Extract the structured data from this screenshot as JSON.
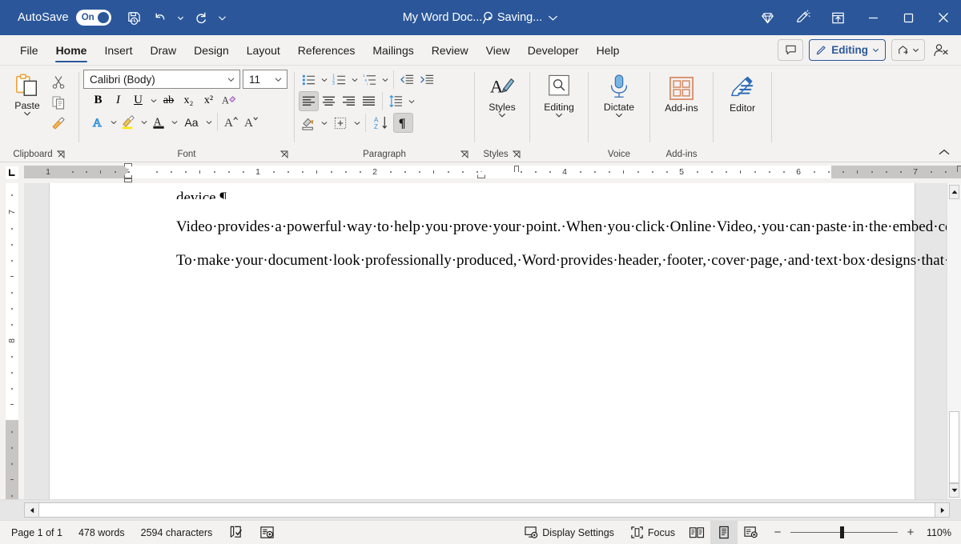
{
  "titlebar": {
    "autosave_label": "AutoSave",
    "autosave_state": "On",
    "doc_title": "My Word Doc...",
    "separator": "•",
    "save_status": "Saving...",
    "bg_color": "#2b579a",
    "qat": [
      {
        "name": "save-icon",
        "tooltip": "Save"
      },
      {
        "name": "undo-icon",
        "tooltip": "Undo"
      },
      {
        "name": "undo-dropdown-icon",
        "tooltip": "Undo options"
      },
      {
        "name": "redo-icon",
        "tooltip": "Redo"
      },
      {
        "name": "customize-quick-access-toolbar-icon",
        "tooltip": "Customize Quick Access Toolbar"
      }
    ],
    "search": {
      "name": "search-icon",
      "tooltip": "Search"
    },
    "right_buttons": [
      {
        "name": "diamond-icon",
        "tooltip": "Microsoft 365"
      },
      {
        "name": "copilot-icon",
        "tooltip": "Copilot"
      },
      {
        "name": "ribbon-display-options-icon",
        "tooltip": "Ribbon Display Options"
      },
      {
        "name": "minimize-icon",
        "tooltip": "Minimize"
      },
      {
        "name": "maximize-icon",
        "tooltip": "Restore Down"
      },
      {
        "name": "close-icon",
        "tooltip": "Close"
      }
    ]
  },
  "tabs": [
    {
      "label": "File",
      "active": false
    },
    {
      "label": "Home",
      "active": true
    },
    {
      "label": "Insert",
      "active": false
    },
    {
      "label": "Draw",
      "active": false
    },
    {
      "label": "Design",
      "active": false
    },
    {
      "label": "Layout",
      "active": false
    },
    {
      "label": "References",
      "active": false
    },
    {
      "label": "Mailings",
      "active": false
    },
    {
      "label": "Review",
      "active": false
    },
    {
      "label": "View",
      "active": false
    },
    {
      "label": "Developer",
      "active": false
    },
    {
      "label": "Help",
      "active": false
    }
  ],
  "tabbar_right": {
    "comments_label": "",
    "editing_label": "Editing",
    "share_label": "",
    "accent_color": "#2b579a"
  },
  "ribbon": {
    "groups": [
      {
        "label": "Clipboard",
        "has_launcher": true
      },
      {
        "label": "Font",
        "has_launcher": true
      },
      {
        "label": "Paragraph",
        "has_launcher": true
      },
      {
        "label": "Styles",
        "has_launcher": true
      },
      {
        "label": "",
        "has_launcher": false
      },
      {
        "label": "Voice",
        "has_launcher": false
      },
      {
        "label": "Add-ins",
        "has_launcher": false
      },
      {
        "label": "",
        "has_launcher": false
      }
    ],
    "clipboard": {
      "paste_label": "Paste",
      "cut_name": "cut-icon",
      "copy_name": "copy-icon",
      "format_painter_name": "format-painter-icon"
    },
    "font": {
      "font_name": "Calibri (Body)",
      "font_size": "11",
      "bold": "B",
      "italic": "I",
      "underline": "U",
      "strikethrough": "ab",
      "subscript": "x₂",
      "superscript": "x²",
      "clear_formatting_name": "clear-formatting-icon",
      "text_effects_name": "text-effects-icon",
      "highlight_name": "text-highlight-color-icon",
      "font_color_name": "font-color-icon",
      "change_case_label": "Aa",
      "grow_font_label": "A",
      "shrink_font_label": "A"
    },
    "paragraph": {
      "bullets_name": "bullets-icon",
      "numbering_name": "numbering-icon",
      "multilevel_name": "multilevel-list-icon",
      "decrease_indent_name": "decrease-indent-icon",
      "increase_indent_name": "increase-indent-icon",
      "align_left_name": "align-left-icon",
      "align_center_name": "align-center-icon",
      "align_right_name": "align-right-icon",
      "justify_name": "justify-icon",
      "line_spacing_name": "line-spacing-icon",
      "shading_name": "shading-icon",
      "borders_name": "borders-icon",
      "sort_name": "sort-icon",
      "show_marks_name": "show-formatting-marks-icon",
      "align_left_selected": true,
      "show_marks_selected": true
    },
    "buttons": [
      {
        "label": "Styles",
        "icon": "styles-icon",
        "has_chevron": true
      },
      {
        "label": "Editing",
        "icon": "editing-search-icon",
        "has_chevron": true
      },
      {
        "label": "Dictate",
        "icon": "dictate-microphone-icon",
        "has_chevron": true
      },
      {
        "label": "Add-ins",
        "icon": "add-ins-icon",
        "has_chevron": false
      },
      {
        "label": "Editor",
        "icon": "editor-pen-icon",
        "has_chevron": false
      }
    ],
    "collapse_name": "collapse-ribbon-icon"
  },
  "ruler": {
    "tab_selector_name": "tab-stop-selector",
    "h_numbers": [
      "1",
      "1",
      "2",
      "4",
      "5",
      "6",
      "7"
    ],
    "v_numbers": [
      "7",
      "8"
    ],
    "left_indent_in": 0.0,
    "right_indent_in": 6.5
  },
  "document": {
    "paragraphs": [
      "device.¶",
      "Video·provides·a·powerful·way·to·help·you·prove·your·point.·When·you·click·Online·Video,·you·can·paste·in·the·embed·code·for·the·video·you·want·to·add.·You·can·also·type·a·keyword·to·search·online·for·the·video·that·best·fits·your·document.¶",
      "To·make·your·document·look·professionally·produced,·Word·provides·header,·footer,·cover·page,·and·text·box·designs·that·complement·"
    ],
    "annotation": {
      "name": "red-arrow-annotation",
      "color": "#ee5340"
    }
  },
  "statusbar": {
    "page_info": "Page 1 of 1",
    "word_count": "478 words",
    "char_count": "2594 characters",
    "proofing_name": "proofing-errors-icon",
    "accessibility_name": "accessibility-checker-icon",
    "display_settings": "Display Settings",
    "focus": "Focus",
    "views": [
      {
        "name": "read-mode-view-icon",
        "active": false
      },
      {
        "name": "print-layout-view-icon",
        "active": true
      },
      {
        "name": "web-layout-view-icon",
        "active": false
      }
    ],
    "zoom_out": "−",
    "zoom_in": "+",
    "zoom_value": "110%"
  }
}
